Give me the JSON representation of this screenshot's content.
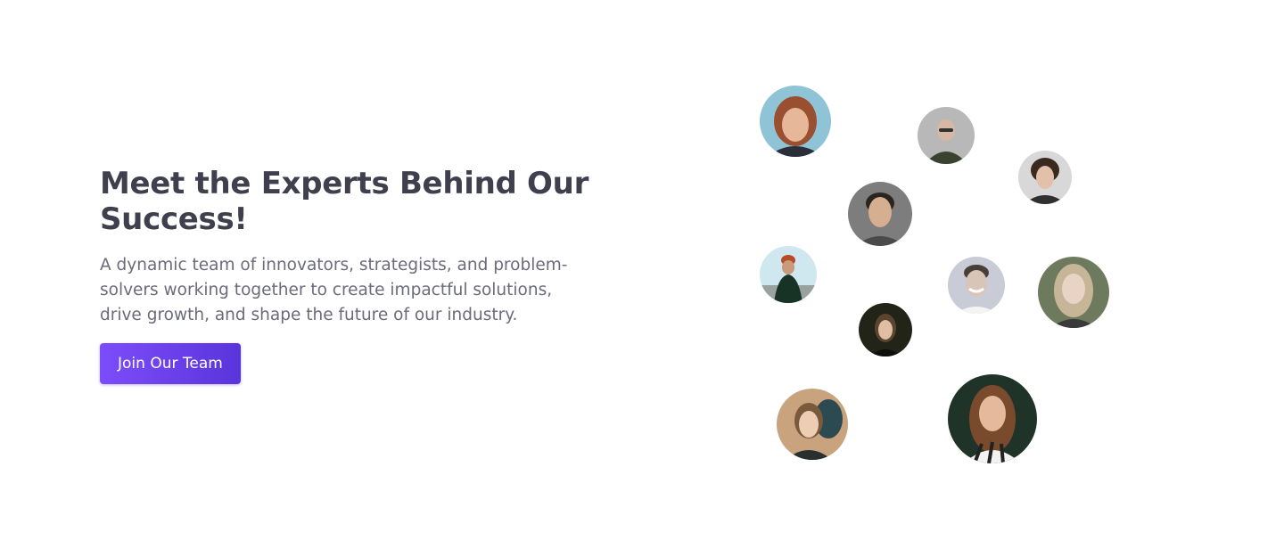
{
  "hero": {
    "title": "Meet the Experts Behind Our Success!",
    "description": "A dynamic team of innovators, strategists, and problem-solvers working together to create impactful solutions, drive growth, and shape the future of our industry.",
    "cta_label": "Join Our Team"
  },
  "colors": {
    "accent": "#6c42f5",
    "heading": "#3f3f4e",
    "body": "#6b6b7b"
  },
  "team_avatars": [
    {
      "name": "avatar-woman-red-hair",
      "icon": "person-photo"
    },
    {
      "name": "avatar-bald-man",
      "icon": "person-photo"
    },
    {
      "name": "avatar-curly-hair-teen",
      "icon": "person-photo"
    },
    {
      "name": "avatar-young-man",
      "icon": "person-photo"
    },
    {
      "name": "avatar-man-beanie",
      "icon": "person-photo"
    },
    {
      "name": "avatar-smiling-man",
      "icon": "person-photo"
    },
    {
      "name": "avatar-blonde-girl",
      "icon": "person-photo"
    },
    {
      "name": "avatar-girl-dark-bg",
      "icon": "person-photo"
    },
    {
      "name": "avatar-woman-tan-bg",
      "icon": "person-photo"
    },
    {
      "name": "avatar-woman-long-hair",
      "icon": "person-photo"
    }
  ]
}
